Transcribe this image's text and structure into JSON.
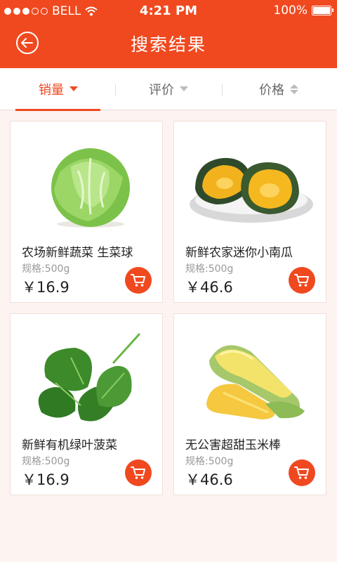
{
  "status_bar": {
    "carrier": "BELL",
    "time": "4:21 PM",
    "battery": "100%"
  },
  "header": {
    "title": "搜索结果",
    "back_icon": "back-arrow-icon"
  },
  "tabs": [
    {
      "label": "销量",
      "active": true,
      "icon": "caret-down-icon"
    },
    {
      "label": "评价",
      "active": false,
      "icon": "caret-down-icon"
    },
    {
      "label": "价格",
      "active": false,
      "icon": "sort-updown-icon"
    }
  ],
  "products": [
    {
      "name": "农场新鲜蔬菜 生菜球",
      "spec": "规格:500g",
      "price": "￥16.9",
      "image": "lettuce"
    },
    {
      "name": "新鲜农家迷你小南瓜",
      "spec": "规格:500g",
      "price": "￥46.6",
      "image": "pumpkin"
    },
    {
      "name": "新鲜有机绿叶菠菜",
      "spec": "规格:500g",
      "price": "￥16.9",
      "image": "spinach"
    },
    {
      "name": "无公害超甜玉米棒",
      "spec": "规格:500g",
      "price": "￥46.6",
      "image": "corn"
    }
  ],
  "colors": {
    "accent": "#f0491f",
    "background": "#fdf3f0"
  }
}
